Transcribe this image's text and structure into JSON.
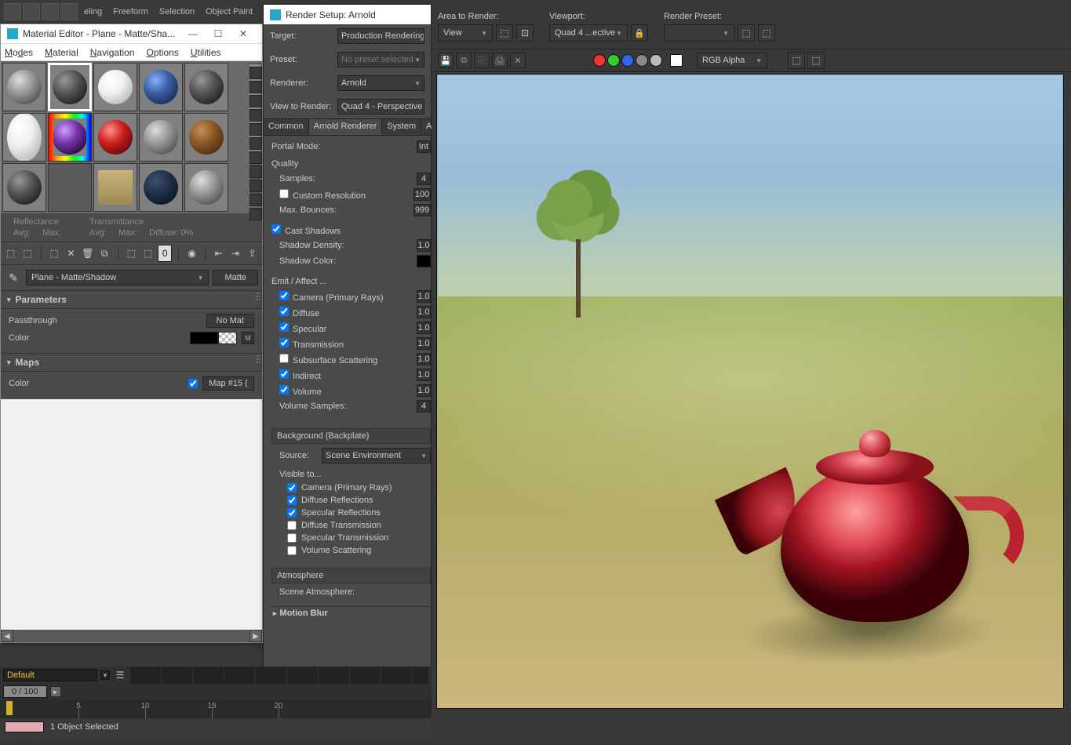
{
  "ribbon": {
    "labels": [
      "eling",
      "Freeform",
      "Selection",
      "Object Paint"
    ]
  },
  "materialEditor": {
    "title": "Material Editor - Plane - Matte/Sha...",
    "menus": {
      "modes": "Modes",
      "material": "Material",
      "navigation": "Navigation",
      "options": "Options",
      "utilities": "Utilities"
    },
    "reflect_title": "Reflectance",
    "reflect_avg": "Avg:",
    "reflect_max": "Max:",
    "trans_title": "Transmittance",
    "trans_avg": "Avg:",
    "trans_max": "Max:",
    "diffuse_label": "Diffuse:",
    "diffuse_val": "0%",
    "selected_material": "Plane - Matte/Shadow",
    "type_btn": "Matte",
    "rollout_params": "Parameters",
    "param_passthrough": "Passthrough",
    "btn_nomat": "No Mat",
    "param_color": "Color",
    "m_letter": "M",
    "rollout_maps": "Maps",
    "maps_color": "Color",
    "btn_map": "Map #15  ("
  },
  "renderSetup": {
    "title": "Render Setup: Arnold",
    "rows": {
      "target_lbl": "Target:",
      "target_val": "Production Rendering Mo",
      "preset_lbl": "Preset:",
      "preset_val": "No preset selected",
      "renderer_lbl": "Renderer:",
      "renderer_val": "Arnold",
      "view_lbl": "View to Render:",
      "view_val": "Quad 4 - Perspective"
    },
    "tabs": {
      "common": "Common",
      "arnold": "Arnold Renderer",
      "system": "System",
      "aov": "AOV"
    },
    "params": {
      "portal_mode_lbl": "Portal Mode:",
      "portal_mode_val": "Int",
      "quality": "Quality",
      "samples_lbl": "Samples:",
      "samples_val": "4",
      "custom_res": "Custom Resolution",
      "custom_res_val": "100",
      "maxbounces_lbl": "Max. Bounces:",
      "maxbounces_val": "999",
      "cast_shadows": "Cast Shadows",
      "shadow_density_lbl": "Shadow Density:",
      "shadow_density_val": "1.0",
      "shadow_color_lbl": "Shadow Color:",
      "emit_affect": "Emit / Affect ...",
      "camera": "Camera (Primary Rays)",
      "camera_v": "1.0",
      "diffuse": "Diffuse",
      "diffuse_v": "1.0",
      "specular": "Specular",
      "specular_v": "1.0",
      "transmission": "Transmission",
      "transmission_v": "1.0",
      "sss": "Subsurface Scattering",
      "sss_v": "1.0",
      "indirect": "Indirect",
      "indirect_v": "1.0",
      "volume": "Volume",
      "volume_v": "1.0",
      "volsamples_lbl": "Volume Samples:",
      "volsamples_v": "4",
      "background": "Background (Backplate)",
      "source_lbl": "Source:",
      "source_val": "Scene Environment",
      "visible_to": "Visible to...",
      "v_cam": "Camera (Primary Rays)",
      "v_diffrefl": "Diffuse Reflections",
      "v_specrefl": "Specular Reflections",
      "v_difftrans": "Diffuse Transmission",
      "v_spectrans": "Specular Transmission",
      "v_volscatter": "Volume Scattering",
      "atmosphere": "Atmosphere",
      "scene_atmo": "Scene Atmosphere:",
      "motion_blur": "Motion Blur"
    }
  },
  "rfw": {
    "area_lbl": "Area to Render:",
    "area_val": "View",
    "viewport_lbl": "Viewport:",
    "viewport_val": "Quad 4 ...ective",
    "preset_lbl": "Render Preset:",
    "preset_val": "",
    "channel_val": "RGB Alpha"
  },
  "timeline": {
    "track_name": "Default",
    "frame": "0 / 100",
    "ticks": [
      "5",
      "10",
      "15",
      "20"
    ]
  },
  "status": {
    "text": "1 Object Selected"
  }
}
